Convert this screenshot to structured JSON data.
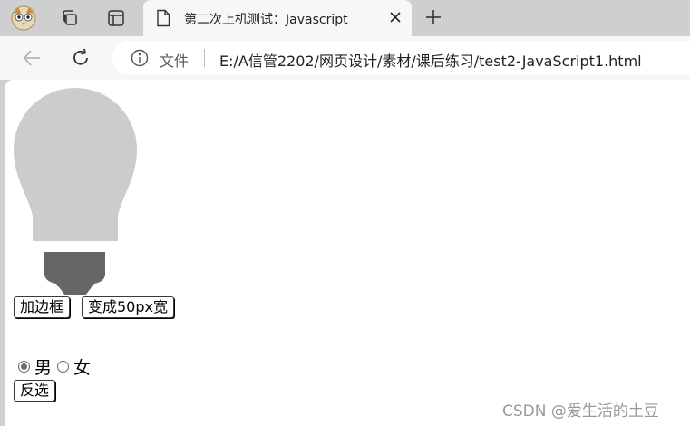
{
  "browser": {
    "tab": {
      "title": "第二次上机测试：Javascript"
    },
    "address": {
      "site_label": "文件",
      "url": "E:/A信管2202/网页设计/素材/课后练习/test2-JavaScript1.html"
    }
  },
  "page": {
    "buttons": {
      "add_border": "加边框",
      "width_50": "变成50px宽",
      "invert": "反选"
    },
    "radios": [
      {
        "label": "男",
        "checked": true
      },
      {
        "label": "女",
        "checked": false
      }
    ],
    "bulb": {
      "glass_color": "#cccccc",
      "base_color": "#666666"
    }
  },
  "watermark": "CSDN @爱生活的土豆"
}
